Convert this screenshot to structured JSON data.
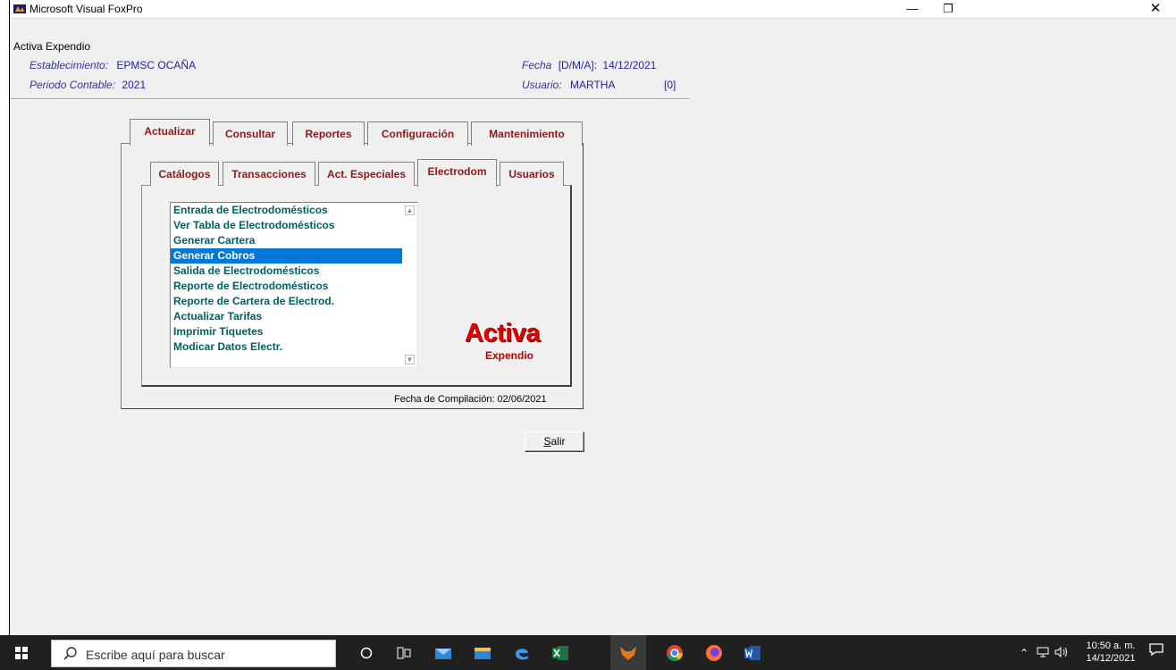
{
  "window": {
    "title": "Microsoft Visual FoxPro",
    "minimize": "—",
    "restore": "❐",
    "close": "✕"
  },
  "form": {
    "caption": "Activa Expendio",
    "establecimiento_label": "Establecimiento:",
    "establecimiento_value": "EPMSC OCAÑA",
    "periodo_label": "Periodo Contable:",
    "periodo_value": "2021",
    "fecha_label": "Fecha",
    "fecha_format": "[D/M/A]:",
    "fecha_value": "14/12/2021",
    "usuario_label": "Usuario:",
    "usuario_value": "MARTHA",
    "usuario_code": "[0]"
  },
  "main_tabs": [
    {
      "label": "Actualizar",
      "active": true
    },
    {
      "label": "Consultar",
      "active": false
    },
    {
      "label": "Reportes",
      "active": false
    },
    {
      "label": "Configuración",
      "active": false
    },
    {
      "label": "Mantenimiento",
      "active": false
    }
  ],
  "sub_tabs": [
    {
      "label": "Catálogos",
      "active": false
    },
    {
      "label": "Transacciones",
      "active": false
    },
    {
      "label": "Act. Especiales",
      "active": false
    },
    {
      "label": "Electrodom",
      "active": true
    },
    {
      "label": "Usuarios",
      "active": false
    }
  ],
  "list_items": [
    {
      "label": "Entrada de Electrodomésticos",
      "selected": false
    },
    {
      "label": "Ver Tabla de Electrodomésticos",
      "selected": false
    },
    {
      "label": "Generar Cartera",
      "selected": false
    },
    {
      "label": "Generar Cobros",
      "selected": true
    },
    {
      "label": "Salida de Electrodomésticos",
      "selected": false
    },
    {
      "label": "Reporte de Electrodomésticos",
      "selected": false
    },
    {
      "label": "Reporte de Cartera de Electrod.",
      "selected": false
    },
    {
      "label": "Actualizar Tarifas",
      "selected": false
    },
    {
      "label": "Imprimir Tiquetes",
      "selected": false
    },
    {
      "label": "Modicar Datos Electr.",
      "selected": false
    }
  ],
  "brand": {
    "name": "Activa",
    "sub": "Expendio",
    "color": "#e00000"
  },
  "compile_text": "Fecha de Compilación: 02/06/2021",
  "salir_label": "alir",
  "salir_accel": "S",
  "taskbar": {
    "search_placeholder": "Escribe aquí para buscar",
    "clock_time": "10:50 a. m.",
    "clock_date": "14/12/2021"
  }
}
